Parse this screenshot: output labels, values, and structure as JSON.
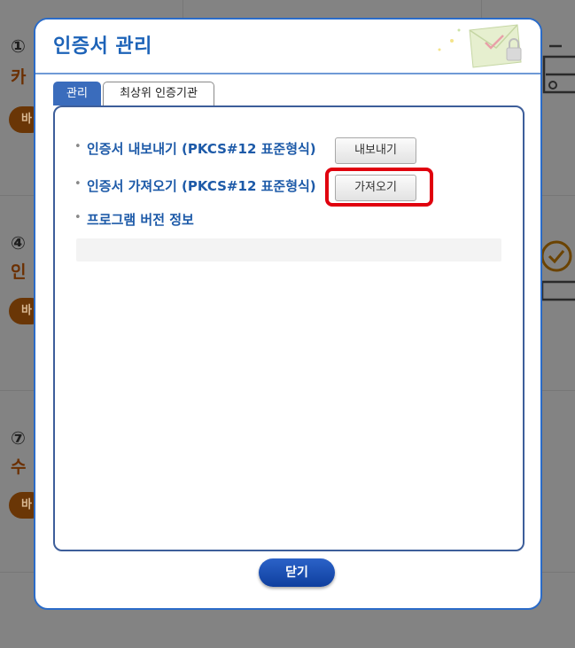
{
  "background": {
    "steps": [
      {
        "number": "①",
        "title": "카",
        "button": "바"
      },
      {
        "number": "④",
        "title": "인",
        "button": "바"
      },
      {
        "number": "⑦",
        "title": "수",
        "button": "바"
      }
    ]
  },
  "dialog": {
    "title": "인증서 관리",
    "tabs": [
      {
        "label": "관리",
        "active": true
      },
      {
        "label": "최상위 인증기관",
        "active": false
      }
    ],
    "items": [
      {
        "label": "인증서 내보내기 (PKCS#12 표준형식)",
        "button": "내보내기"
      },
      {
        "label": "인증서 가져오기 (PKCS#12 표준형식)",
        "button": "가져오기"
      },
      {
        "label": "프로그램 버전 정보"
      }
    ],
    "version_text": "",
    "close_label": "닫기"
  },
  "colors": {
    "accent": "#1d63b8",
    "tab_active": "#3a6cbc",
    "highlight": "#e0000e",
    "close_button": "#1a4db0"
  },
  "icons": {
    "header_decoration": "certificate-envelope-icon",
    "background_icons": [
      "lock-icon",
      "check-circle-icon"
    ]
  }
}
